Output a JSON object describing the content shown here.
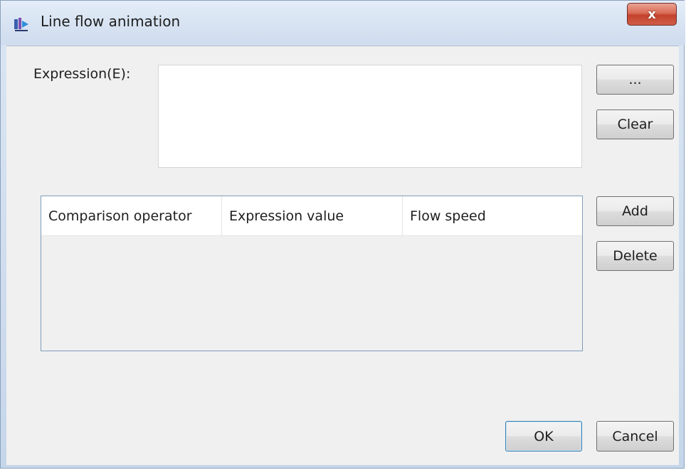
{
  "window": {
    "title": "Line flow animation",
    "close_symbol": "x"
  },
  "expression": {
    "label": "Expression(E):",
    "value": ""
  },
  "buttons": {
    "browse": "...",
    "clear": "Clear",
    "add": "Add",
    "delete": "Delete",
    "ok": "OK",
    "cancel": "Cancel"
  },
  "table": {
    "columns": [
      "Comparison operator",
      "Expression value",
      "Flow speed"
    ],
    "rows": []
  },
  "icons": {
    "title_icon": "app-icon",
    "close_icon": "close-icon"
  },
  "colors": {
    "close_button": "#c5422d",
    "dialog_bg": "#f0f0f0",
    "ok_border": "#3c7fb1"
  }
}
